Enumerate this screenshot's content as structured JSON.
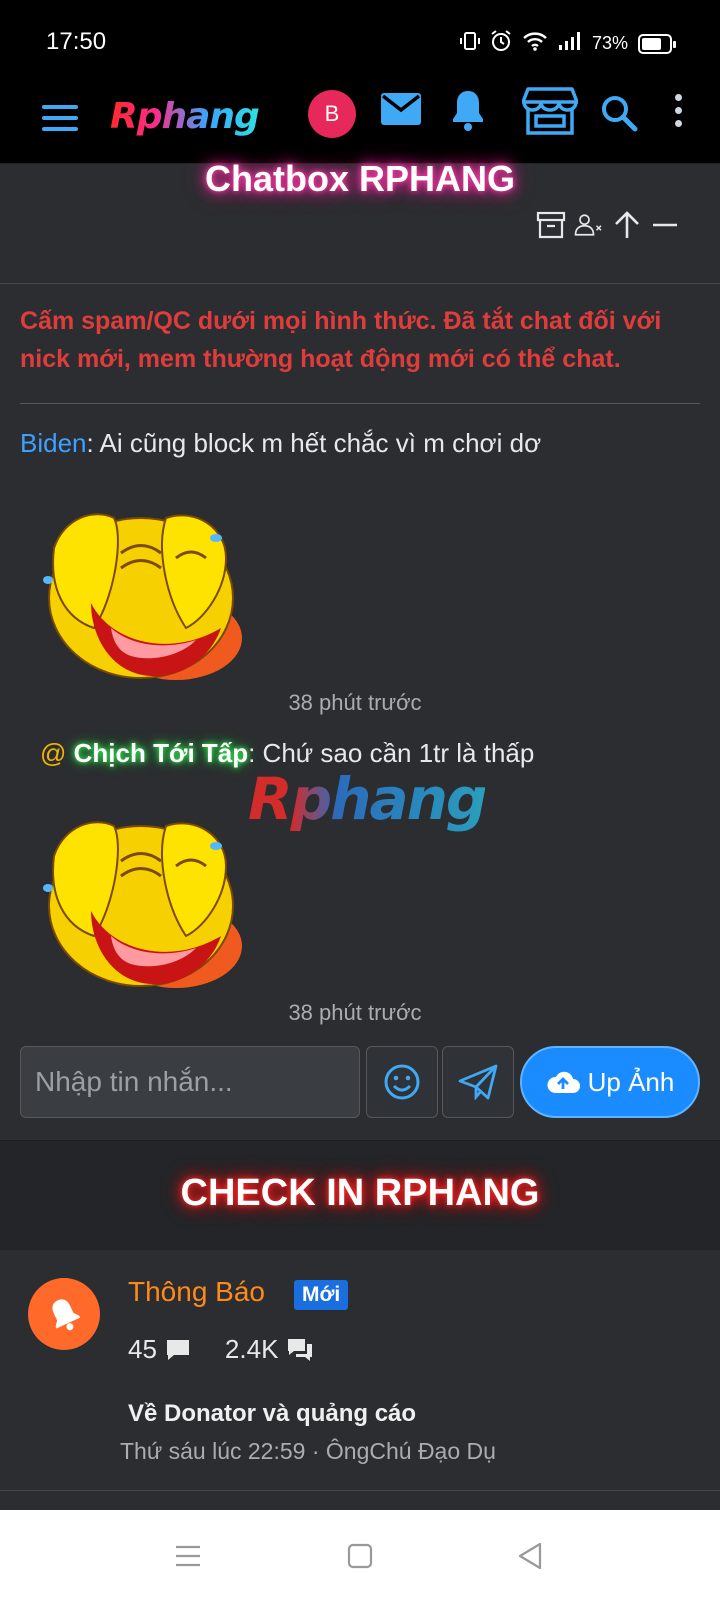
{
  "status_bar": {
    "time": "17:50",
    "battery": "73%"
  },
  "nav": {
    "logo": "Rphang",
    "avatar_letter": "B"
  },
  "chatbox": {
    "title": "Chatbox RPHANG",
    "notice": "Cấm spam/QC dưới mọi hình thức. Đã tắt chat đối với nick mới, mem thường hoạt động mới có thể chat.",
    "messages": [
      {
        "user": "Biden",
        "text": ": Ai cũng block m hết chắc vì m chơi dơ",
        "time": "38 phút trước"
      },
      {
        "at": "@ ",
        "user": "Chịch Tới Tấp",
        "text": ": Chứ sao cần 1tr là thấp",
        "time": "38 phút trước"
      }
    ],
    "watermark": "Rphang",
    "input_placeholder": "Nhập tin nhắn...",
    "upload_label": "Up Ảnh"
  },
  "checkin": {
    "title": "CHECK IN RPHANG"
  },
  "node": {
    "title": "Thông Báo",
    "badge": "Mới",
    "threads": "45",
    "messages": "2.4K",
    "latest_title": "Về Donator và quảng cáo",
    "latest_meta": "Thứ sáu lúc 22:59 · ÔngChú Đạo Dụ"
  },
  "colors": {
    "accent": "#3fa9f5",
    "danger": "#e03c3c",
    "node_title": "#ff8a1a",
    "badge": "#1a6fe0"
  }
}
